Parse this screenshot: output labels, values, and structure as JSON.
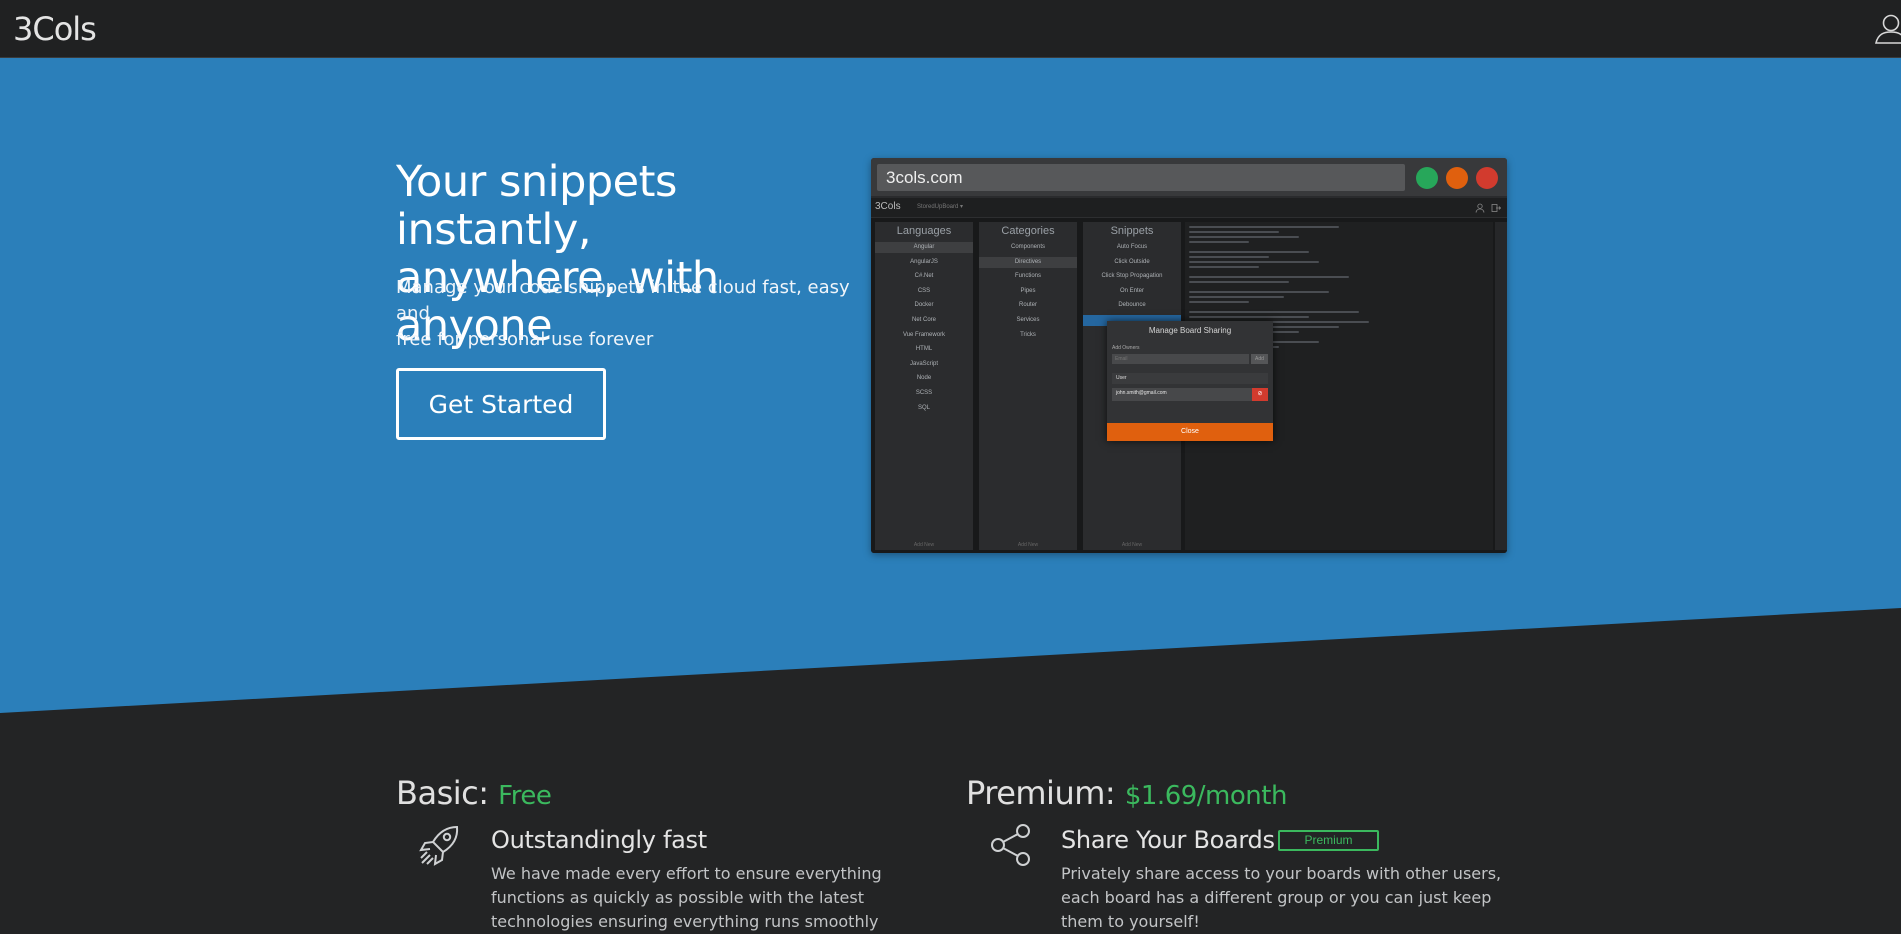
{
  "nav": {
    "brand": "3Cols",
    "user_icon": "user-icon"
  },
  "hero": {
    "title_line1": "Your snippets instantly,",
    "title_line2": "anywhere, with anyone",
    "subtitle_line1": "Manage your code snippets in the cloud fast, easy and",
    "subtitle_line2": "free for personal use forever",
    "cta_label": "Get Started"
  },
  "preview": {
    "url": "3cols.com",
    "window_dots": [
      {
        "name": "green",
        "color": "#27a75a"
      },
      {
        "name": "orange",
        "color": "#e0600e"
      },
      {
        "name": "red",
        "color": "#d23b2e"
      }
    ],
    "app_brand": "3Cols",
    "breadcrumb": "StoredUpBoard ▾",
    "columns": [
      {
        "header": "Languages",
        "items": [
          "Angular",
          "AngularJS",
          "C#.Net",
          "CSS",
          "Docker",
          "Net Core",
          "Vue Framework",
          "HTML",
          "JavaScript",
          "Node",
          "SCSS",
          "SQL"
        ],
        "selected": 0,
        "footer": "Add New"
      },
      {
        "header": "Categories",
        "items": [
          "Components",
          "Directives",
          "Functions",
          "Pipes",
          "Router",
          "Services",
          "Tricks"
        ],
        "selected": 1,
        "footer": "Add New"
      },
      {
        "header": "Snippets",
        "items": [
          "Auto Focus",
          "Click Outside",
          "Click Stop Propagation",
          "On Enter",
          "Debounce",
          ""
        ],
        "selected": 5,
        "footer": "Add New"
      }
    ],
    "modal": {
      "title": "Manage Board Sharing",
      "add_label": "Add Owners",
      "input_placeholder": "Email",
      "add_button": "Add",
      "list_header": "User",
      "user_email": "john.smith@gmail.com",
      "close_label": "Close",
      "accent": "#e0600e"
    }
  },
  "plans": {
    "basic": {
      "label": "Basic:",
      "price": "Free",
      "feature_icon": "rocket-icon",
      "feature_title": "Outstandingly fast",
      "feature_text": "We have made every effort to ensure everything functions as quickly as possible with the latest technologies ensuring everything runs smoothly"
    },
    "premium": {
      "label": "Premium:",
      "price": "$1.69/month",
      "feature_icon": "share-icon",
      "feature_title": "Share Your Boards",
      "badge": "Premium",
      "feature_text": "Privately share access to your boards with other users, each board has a different group or you can just keep them to yourself!"
    }
  },
  "colors": {
    "hero_blue": "#2b7fba",
    "dark": "#232425",
    "accent_green": "#3bb95e"
  }
}
